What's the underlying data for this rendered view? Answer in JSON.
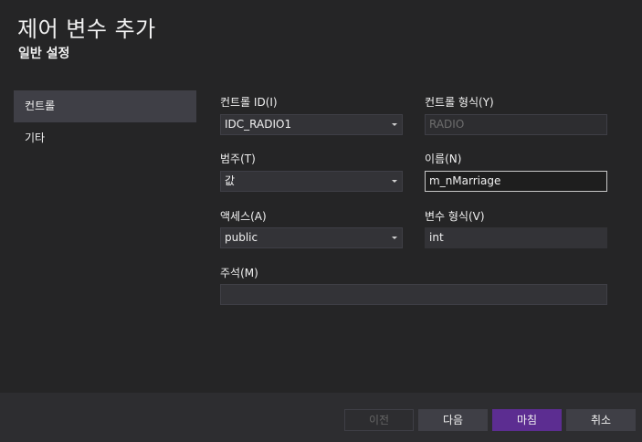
{
  "header": {
    "title": "제어 변수 추가",
    "subtitle": "일반 설정"
  },
  "nav": {
    "items": [
      {
        "label": "컨트롤",
        "active": true
      },
      {
        "label": "기타",
        "active": false
      }
    ]
  },
  "form": {
    "control_id": {
      "label": "컨트롤 ID(I)",
      "value": "IDC_RADIO1"
    },
    "control_type": {
      "label": "컨트롤 형식(Y)",
      "value": "RADIO"
    },
    "category": {
      "label": "범주(T)",
      "value": "값"
    },
    "name": {
      "label": "이름(N)",
      "value": "m_nMarriage"
    },
    "access": {
      "label": "액세스(A)",
      "value": "public"
    },
    "variable_type": {
      "label": "변수 형식(V)",
      "value": "int"
    },
    "comment": {
      "label": "주석(M)",
      "value": ""
    }
  },
  "footer": {
    "back_label": "이전",
    "next_label": "다음",
    "finish_label": "마침",
    "cancel_label": "취소"
  },
  "colors": {
    "background": "#252526",
    "footer": "#2d2d30",
    "input": "#333337",
    "accent": "#5c2d91"
  }
}
